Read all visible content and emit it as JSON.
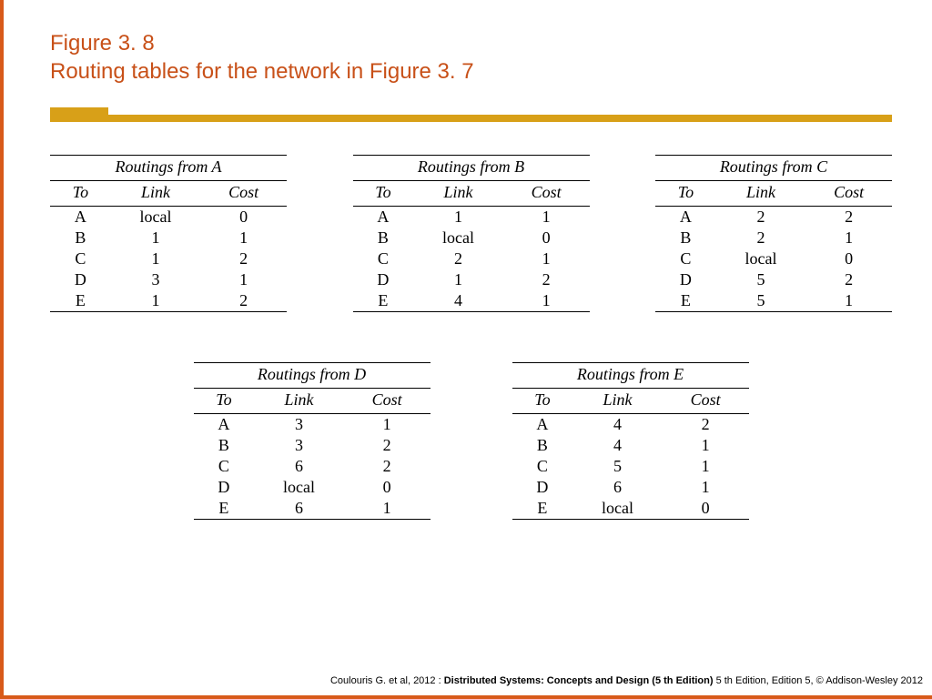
{
  "heading": {
    "line1": "Figure 3. 8",
    "line2": "Routing tables for the network in Figure 3. 7"
  },
  "columns": [
    "To",
    "Link",
    "Cost"
  ],
  "tables": {
    "A": {
      "title": "Routings from A",
      "rows": [
        {
          "to": "A",
          "link": "local",
          "cost": "0"
        },
        {
          "to": "B",
          "link": "1",
          "cost": "1"
        },
        {
          "to": "C",
          "link": "1",
          "cost": "2"
        },
        {
          "to": "D",
          "link": "3",
          "cost": "1"
        },
        {
          "to": "E",
          "link": "1",
          "cost": "2"
        }
      ]
    },
    "B": {
      "title": "Routings from B",
      "rows": [
        {
          "to": "A",
          "link": "1",
          "cost": "1"
        },
        {
          "to": "B",
          "link": "local",
          "cost": "0"
        },
        {
          "to": "C",
          "link": "2",
          "cost": "1"
        },
        {
          "to": "D",
          "link": "1",
          "cost": "2"
        },
        {
          "to": "E",
          "link": "4",
          "cost": "1"
        }
      ]
    },
    "C": {
      "title": "Routings from C",
      "rows": [
        {
          "to": "A",
          "link": "2",
          "cost": "2"
        },
        {
          "to": "B",
          "link": "2",
          "cost": "1"
        },
        {
          "to": "C",
          "link": "local",
          "cost": "0"
        },
        {
          "to": "D",
          "link": "5",
          "cost": "2"
        },
        {
          "to": "E",
          "link": "5",
          "cost": "1"
        }
      ]
    },
    "D": {
      "title": "Routings from D",
      "rows": [
        {
          "to": "A",
          "link": "3",
          "cost": "1"
        },
        {
          "to": "B",
          "link": "3",
          "cost": "2"
        },
        {
          "to": "C",
          "link": "6",
          "cost": "2"
        },
        {
          "to": "D",
          "link": "local",
          "cost": "0"
        },
        {
          "to": "E",
          "link": "6",
          "cost": "1"
        }
      ]
    },
    "E": {
      "title": "Routings from E",
      "rows": [
        {
          "to": "A",
          "link": "4",
          "cost": "2"
        },
        {
          "to": "B",
          "link": "4",
          "cost": "1"
        },
        {
          "to": "C",
          "link": "5",
          "cost": "1"
        },
        {
          "to": "D",
          "link": "6",
          "cost": "1"
        },
        {
          "to": "E",
          "link": "local",
          "cost": "0"
        }
      ]
    }
  },
  "footer": {
    "prefix": "Coulouris G. et al, 2012 : ",
    "bold": "Distributed Systems: Concepts and Design (5 th Edition)",
    "suffix": " 5 th Edition, Edition 5, © Addison-Wesley 2012"
  },
  "chart_data": [
    {
      "type": "table",
      "title": "Routings from A",
      "columns": [
        "To",
        "Link",
        "Cost"
      ],
      "rows": [
        [
          "A",
          "local",
          0
        ],
        [
          "B",
          1,
          1
        ],
        [
          "C",
          1,
          2
        ],
        [
          "D",
          3,
          1
        ],
        [
          "E",
          1,
          2
        ]
      ]
    },
    {
      "type": "table",
      "title": "Routings from B",
      "columns": [
        "To",
        "Link",
        "Cost"
      ],
      "rows": [
        [
          "A",
          1,
          1
        ],
        [
          "B",
          "local",
          0
        ],
        [
          "C",
          2,
          1
        ],
        [
          "D",
          1,
          2
        ],
        [
          "E",
          4,
          1
        ]
      ]
    },
    {
      "type": "table",
      "title": "Routings from C",
      "columns": [
        "To",
        "Link",
        "Cost"
      ],
      "rows": [
        [
          "A",
          2,
          2
        ],
        [
          "B",
          2,
          1
        ],
        [
          "C",
          "local",
          0
        ],
        [
          "D",
          5,
          2
        ],
        [
          "E",
          5,
          1
        ]
      ]
    },
    {
      "type": "table",
      "title": "Routings from D",
      "columns": [
        "To",
        "Link",
        "Cost"
      ],
      "rows": [
        [
          "A",
          3,
          1
        ],
        [
          "B",
          3,
          2
        ],
        [
          "C",
          6,
          2
        ],
        [
          "D",
          "local",
          0
        ],
        [
          "E",
          6,
          1
        ]
      ]
    },
    {
      "type": "table",
      "title": "Routings from E",
      "columns": [
        "To",
        "Link",
        "Cost"
      ],
      "rows": [
        [
          "A",
          4,
          2
        ],
        [
          "B",
          4,
          1
        ],
        [
          "C",
          5,
          1
        ],
        [
          "D",
          6,
          1
        ],
        [
          "E",
          "local",
          0
        ]
      ]
    }
  ]
}
